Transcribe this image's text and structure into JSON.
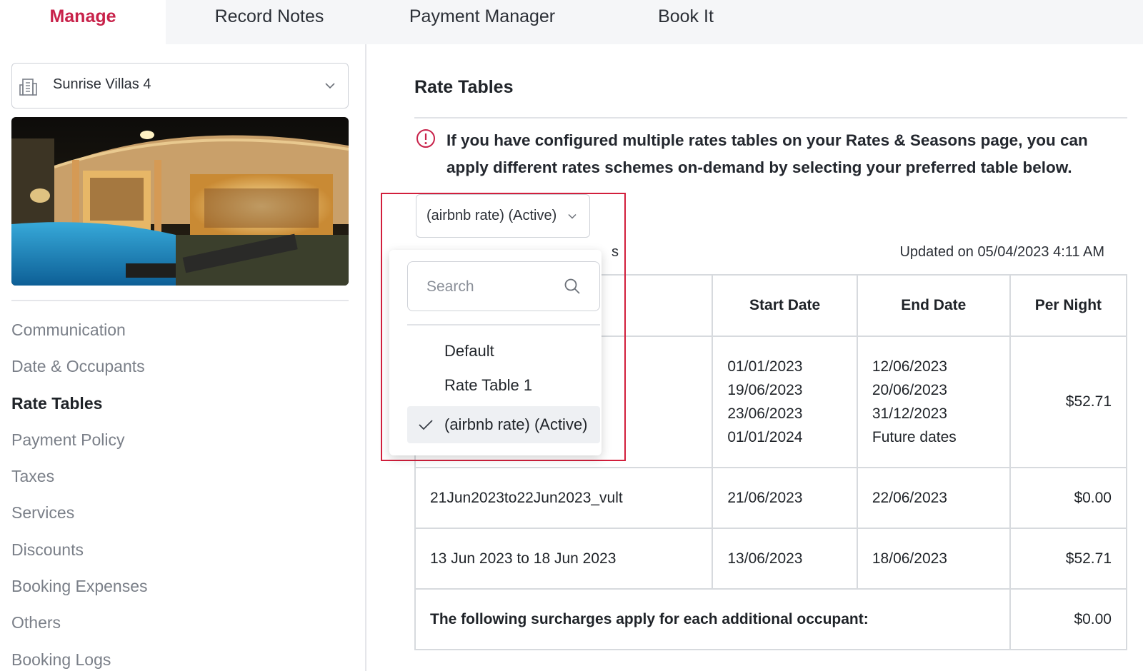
{
  "top_tabs": [
    {
      "label": "Manage",
      "active": true
    },
    {
      "label": "Record Notes",
      "active": false
    },
    {
      "label": "Payment Manager",
      "active": false
    },
    {
      "label": "Book It",
      "active": false
    }
  ],
  "property": {
    "name": "Sunrise Villas 4",
    "icon": "building-icon"
  },
  "sidebar": {
    "items": [
      {
        "label": "Communication"
      },
      {
        "label": "Date & Occupants"
      },
      {
        "label": "Rate Tables",
        "current": true
      },
      {
        "label": "Payment Policy"
      },
      {
        "label": "Taxes"
      },
      {
        "label": "Services"
      },
      {
        "label": "Discounts"
      },
      {
        "label": "Booking Expenses"
      },
      {
        "label": "Others"
      },
      {
        "label": "Booking Logs"
      }
    ]
  },
  "main": {
    "title": "Rate Tables",
    "info": "If you have configured multiple rates tables on your Rates & Seasons page, you can apply different rates schemes on-demand by selecting your preferred table below.",
    "updated": "Updated on 05/04/2023 4:11 AM",
    "peek_text": "s",
    "table": {
      "headers": [
        "",
        "Start Date",
        "End Date",
        "Per Night"
      ],
      "rows": [
        {
          "name": "",
          "start": [
            "01/01/2023",
            "19/06/2023",
            "23/06/2023",
            "01/01/2024"
          ],
          "end": [
            "12/06/2023",
            "20/06/2023",
            "31/12/2023",
            "Future dates"
          ],
          "per_night": "$52.71"
        },
        {
          "name": "21Jun2023to22Jun2023_vult",
          "start": [
            "21/06/2023"
          ],
          "end": [
            "22/06/2023"
          ],
          "per_night": "$0.00"
        },
        {
          "name": "13 Jun 2023 to 18 Jun 2023",
          "start": [
            "13/06/2023"
          ],
          "end": [
            "18/06/2023"
          ],
          "per_night": "$52.71"
        }
      ],
      "surcharge_label": "The following surcharges apply for each additional occupant:",
      "surcharge_value": "$0.00"
    }
  },
  "rate_dropdown": {
    "selected": "(airbnb rate) (Active)",
    "search_placeholder": "Search",
    "options": [
      {
        "label": "Default",
        "selected": false
      },
      {
        "label": "Rate Table 1",
        "selected": false
      },
      {
        "label": "(airbnb rate) (Active)",
        "selected": true
      }
    ]
  },
  "colors": {
    "accent": "#c8224a",
    "highlight_border": "#d21f3c",
    "nav_muted": "#7a7f88",
    "border": "#d7dade"
  }
}
